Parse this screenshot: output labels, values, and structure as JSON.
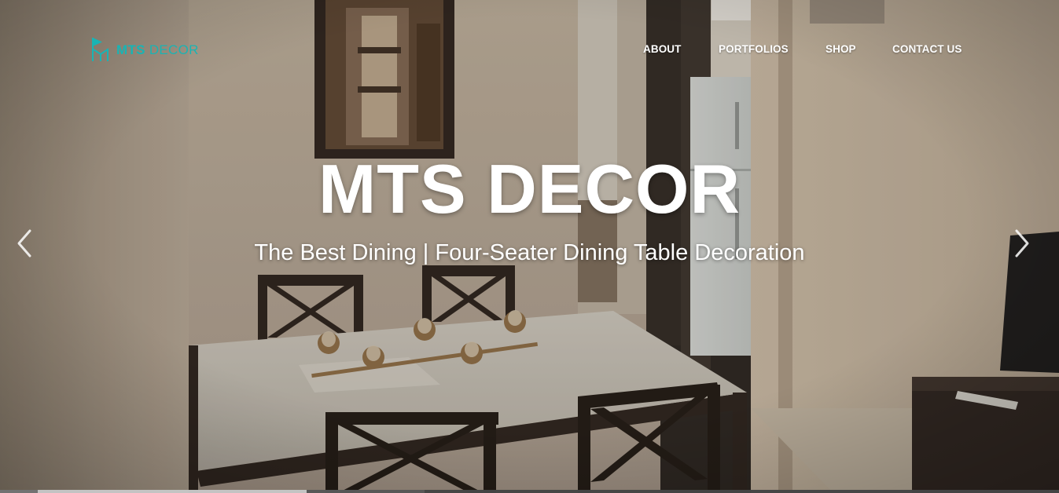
{
  "brand": {
    "name_bold": "MTS",
    "name_light": "DECOR",
    "logo_icon": "chair-flag-logo-icon",
    "color": "#19b4b4"
  },
  "nav": {
    "items": [
      {
        "label": "ABOUT"
      },
      {
        "label": "PORTFOLIOS"
      },
      {
        "label": "SHOP"
      },
      {
        "label": "CONTACT US"
      }
    ]
  },
  "carousel": {
    "title": "MTS DECOR",
    "subtitle": "The Best Dining | Four-Seater Dining Table Decoration",
    "prev_icon": "chevron-left-icon",
    "next_icon": "chevron-right-icon",
    "background_image": "dining-room-photo"
  },
  "colors": {
    "text": "#ffffff",
    "accent": "#19b4b4"
  }
}
